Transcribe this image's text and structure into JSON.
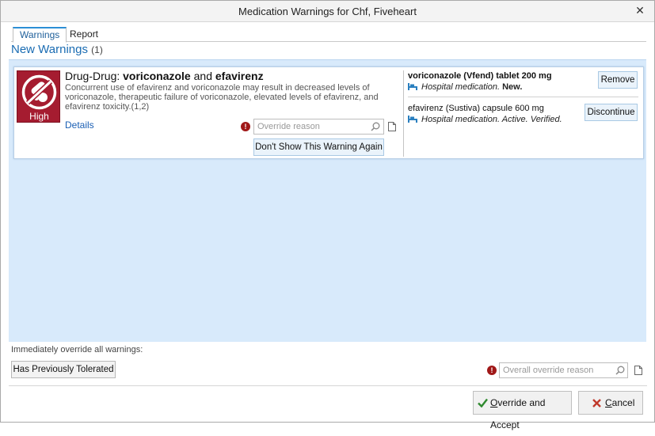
{
  "window": {
    "title": "Medication Warnings for Chf, Fiveheart",
    "close_glyph": "✕"
  },
  "tabs": [
    {
      "label": "Warnings",
      "active": true
    },
    {
      "label": "Report",
      "active": false
    }
  ],
  "heading": {
    "label": "New Warnings",
    "count": "(1)"
  },
  "warning": {
    "severity": "High",
    "severity_color": "#a51c30",
    "title_prefix": "Drug-Drug: ",
    "drug_a": "voriconazole",
    "title_join": " and ",
    "drug_b": "efavirenz",
    "description": "Concurrent use of efavirenz and voriconazole may result in decreased levels of voriconazole, therapeutic failure of voriconazole, elevated levels of efavirenz, and efavirenz toxicity.(1,2)",
    "details_link": "Details",
    "override_placeholder": "Override reason",
    "dont_show_label": "Don't Show This Warning Again"
  },
  "medications": [
    {
      "name": "voriconazole (Vfend) tablet 200 mg",
      "status_prefix": "Hospital medication. ",
      "status_bold": "New.",
      "action_label": "Remove"
    },
    {
      "name": "efavirenz (Sustiva) capsule 600 mg",
      "status_prefix": "Hospital medication. Active. Verified.",
      "status_bold": "",
      "action_label": "Discontinue"
    }
  ],
  "bottom": {
    "override_all_label": "Immediately override all warnings:",
    "tolerated_label": "Has Previously Tolerated",
    "overall_placeholder": "Overall override reason"
  },
  "footer": {
    "accept_label_first": "O",
    "accept_label_rest": "verride and Accept",
    "cancel_label_first": "C",
    "cancel_label_rest": "ancel"
  },
  "icons": {
    "severity": "no-pills-icon",
    "error": "exclamation-circle-icon",
    "search": "magnifier-icon",
    "note": "document-icon",
    "hospital": "hospital-bed-icon",
    "accept": "checkmark-icon",
    "cancel": "x-icon"
  },
  "colors": {
    "accent": "#1a6cb3",
    "panel_bg": "#d8eafb",
    "error_red": "#a01818"
  }
}
